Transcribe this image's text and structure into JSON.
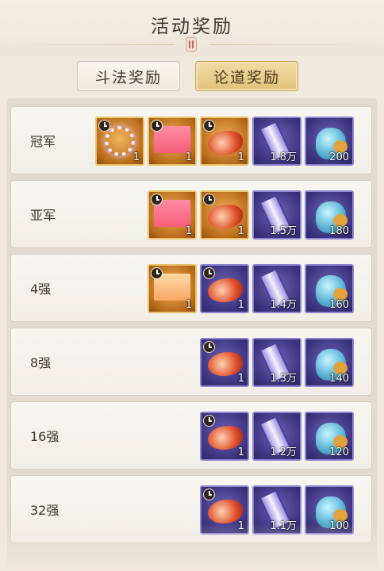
{
  "page": {
    "title": "活动奖励"
  },
  "tabs": [
    {
      "label": "斗法奖励",
      "active": false
    },
    {
      "label": "论道奖励",
      "active": true
    }
  ],
  "colors": {
    "active_tab": "#e1c27a",
    "gold_frame": "#e8c46c",
    "purple_frame": "#8e84d2"
  },
  "rewards": [
    {
      "rank": "冠军",
      "items": [
        {
          "icon": "ring-artifact-icon",
          "frame": "gold",
          "count": "1",
          "timed": true
        },
        {
          "icon": "pink-ticket-icon",
          "frame": "gold",
          "count": "1",
          "timed": true
        },
        {
          "icon": "flame-beast-icon",
          "frame": "gold",
          "count": "1",
          "timed": true
        },
        {
          "icon": "scroll-icon",
          "frame": "purple",
          "count": "1.8万",
          "timed": false
        },
        {
          "icon": "spirit-beast-icon",
          "frame": "purple",
          "count": "200",
          "timed": false
        }
      ]
    },
    {
      "rank": "亚军",
      "items": [
        {
          "icon": "pink-ticket-icon",
          "frame": "gold",
          "count": "1",
          "timed": true
        },
        {
          "icon": "flame-beast-icon",
          "frame": "gold",
          "count": "1",
          "timed": true
        },
        {
          "icon": "scroll-icon",
          "frame": "purple",
          "count": "1.5万",
          "timed": false
        },
        {
          "icon": "spirit-beast-icon",
          "frame": "purple",
          "count": "180",
          "timed": false
        }
      ]
    },
    {
      "rank": "4强",
      "items": [
        {
          "icon": "peach-ticket-icon",
          "frame": "gold",
          "count": "1",
          "timed": true
        },
        {
          "icon": "flame-beast-icon",
          "frame": "purple",
          "count": "1",
          "timed": true
        },
        {
          "icon": "scroll-icon",
          "frame": "purple",
          "count": "1.4万",
          "timed": false
        },
        {
          "icon": "spirit-beast-icon",
          "frame": "purple",
          "count": "160",
          "timed": false
        }
      ]
    },
    {
      "rank": "8强",
      "items": [
        {
          "icon": "flame-beast-icon",
          "frame": "purple",
          "count": "1",
          "timed": true
        },
        {
          "icon": "scroll-icon",
          "frame": "purple",
          "count": "1.3万",
          "timed": false
        },
        {
          "icon": "spirit-beast-icon",
          "frame": "purple",
          "count": "140",
          "timed": false
        }
      ]
    },
    {
      "rank": "16强",
      "items": [
        {
          "icon": "flame-beast-icon",
          "frame": "purple",
          "count": "1",
          "timed": true
        },
        {
          "icon": "scroll-icon",
          "frame": "purple",
          "count": "1.2万",
          "timed": false
        },
        {
          "icon": "spirit-beast-icon",
          "frame": "purple",
          "count": "120",
          "timed": false
        }
      ]
    },
    {
      "rank": "32强",
      "items": [
        {
          "icon": "flame-beast-icon",
          "frame": "purple",
          "count": "1",
          "timed": true
        },
        {
          "icon": "scroll-icon",
          "frame": "purple",
          "count": "1.1万",
          "timed": false
        },
        {
          "icon": "spirit-beast-icon",
          "frame": "purple",
          "count": "100",
          "timed": false
        }
      ]
    }
  ]
}
